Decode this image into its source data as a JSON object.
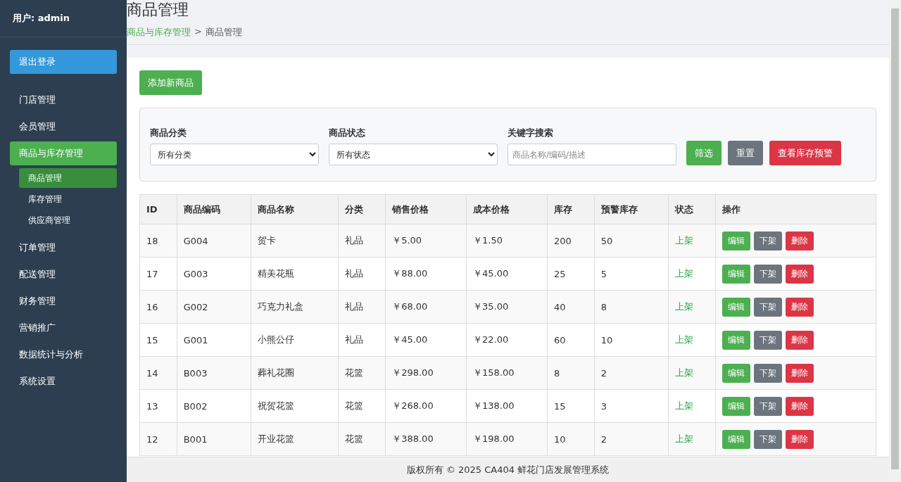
{
  "sidebar": {
    "user": "用户: admin",
    "logout": "退出登录",
    "items": [
      {
        "label": "门店管理",
        "selected": false
      },
      {
        "label": "会员管理",
        "selected": false
      },
      {
        "label": "商品与库存管理",
        "selected": true,
        "children": [
          {
            "label": "商品管理",
            "selected": true
          },
          {
            "label": "库存管理",
            "selected": false
          },
          {
            "label": "供应商管理",
            "selected": false
          }
        ]
      },
      {
        "label": "订单管理",
        "selected": false
      },
      {
        "label": "配送管理",
        "selected": false
      },
      {
        "label": "财务管理",
        "selected": false
      },
      {
        "label": "营销推广",
        "selected": false
      },
      {
        "label": "数据统计与分析",
        "selected": false
      },
      {
        "label": "系统设置",
        "selected": false
      }
    ]
  },
  "header": {
    "title": "商品管理",
    "breadcrumb": [
      {
        "label": "商品与库存管理",
        "kind": "link"
      },
      {
        "label": ">",
        "kind": "separator"
      },
      {
        "label": "商品管理",
        "kind": "current"
      }
    ]
  },
  "add_button": "添加新商品",
  "filters": {
    "fields": [
      {
        "label": "商品分类",
        "kind": "select",
        "value": "所有分类"
      },
      {
        "label": "商品状态",
        "kind": "select",
        "value": "所有状态"
      },
      {
        "label": "关键字搜索",
        "kind": "text",
        "placeholder": "商品名称/编码/描述"
      }
    ],
    "buttons": [
      {
        "label": "筛选",
        "kind": "success"
      },
      {
        "label": "重置",
        "kind": "secondary"
      },
      {
        "label": "查看库存预警",
        "kind": "danger"
      }
    ]
  },
  "table": {
    "columns": [
      "ID",
      "商品编码",
      "商品名称",
      "分类",
      "销售价格",
      "成本价格",
      "库存",
      "预警库存",
      "状态",
      "操作"
    ],
    "rows": [
      {
        "cells": [
          "18",
          "G004",
          "贺卡",
          "礼品",
          "￥5.00",
          "￥1.50",
          "200",
          "50"
        ],
        "status": "上架",
        "actions": [
          {
            "label": "编辑",
            "kind": "success"
          },
          {
            "label": "下架",
            "kind": "secondary"
          },
          {
            "label": "删除",
            "kind": "danger"
          }
        ]
      },
      {
        "cells": [
          "17",
          "G003",
          "精美花瓶",
          "礼品",
          "￥88.00",
          "￥45.00",
          "25",
          "5"
        ],
        "status": "上架",
        "actions": [
          {
            "label": "编辑",
            "kind": "success"
          },
          {
            "label": "下架",
            "kind": "secondary"
          },
          {
            "label": "删除",
            "kind": "danger"
          }
        ]
      },
      {
        "cells": [
          "16",
          "G002",
          "巧克力礼盒",
          "礼品",
          "￥68.00",
          "￥35.00",
          "40",
          "8"
        ],
        "status": "上架",
        "actions": [
          {
            "label": "编辑",
            "kind": "success"
          },
          {
            "label": "下架",
            "kind": "secondary"
          },
          {
            "label": "删除",
            "kind": "danger"
          }
        ]
      },
      {
        "cells": [
          "15",
          "G001",
          "小熊公仔",
          "礼品",
          "￥45.00",
          "￥22.00",
          "60",
          "10"
        ],
        "status": "上架",
        "actions": [
          {
            "label": "编辑",
            "kind": "success"
          },
          {
            "label": "下架",
            "kind": "secondary"
          },
          {
            "label": "删除",
            "kind": "danger"
          }
        ]
      },
      {
        "cells": [
          "14",
          "B003",
          "葬礼花圈",
          "花篮",
          "￥298.00",
          "￥158.00",
          "8",
          "2"
        ],
        "status": "上架",
        "actions": [
          {
            "label": "编辑",
            "kind": "success"
          },
          {
            "label": "下架",
            "kind": "secondary"
          },
          {
            "label": "删除",
            "kind": "danger"
          }
        ]
      },
      {
        "cells": [
          "13",
          "B002",
          "祝贺花篮",
          "花篮",
          "￥268.00",
          "￥138.00",
          "15",
          "3"
        ],
        "status": "上架",
        "actions": [
          {
            "label": "编辑",
            "kind": "success"
          },
          {
            "label": "下架",
            "kind": "secondary"
          },
          {
            "label": "删除",
            "kind": "danger"
          }
        ]
      },
      {
        "cells": [
          "12",
          "B001",
          "开业花篮",
          "花篮",
          "￥388.00",
          "￥198.00",
          "10",
          "2"
        ],
        "status": "上架",
        "actions": [
          {
            "label": "编辑",
            "kind": "success"
          },
          {
            "label": "下架",
            "kind": "secondary"
          },
          {
            "label": "删除",
            "kind": "danger"
          }
        ]
      }
    ]
  },
  "footer": "版权所有 © 2025 CA404 鲜花门店发展管理系统"
}
